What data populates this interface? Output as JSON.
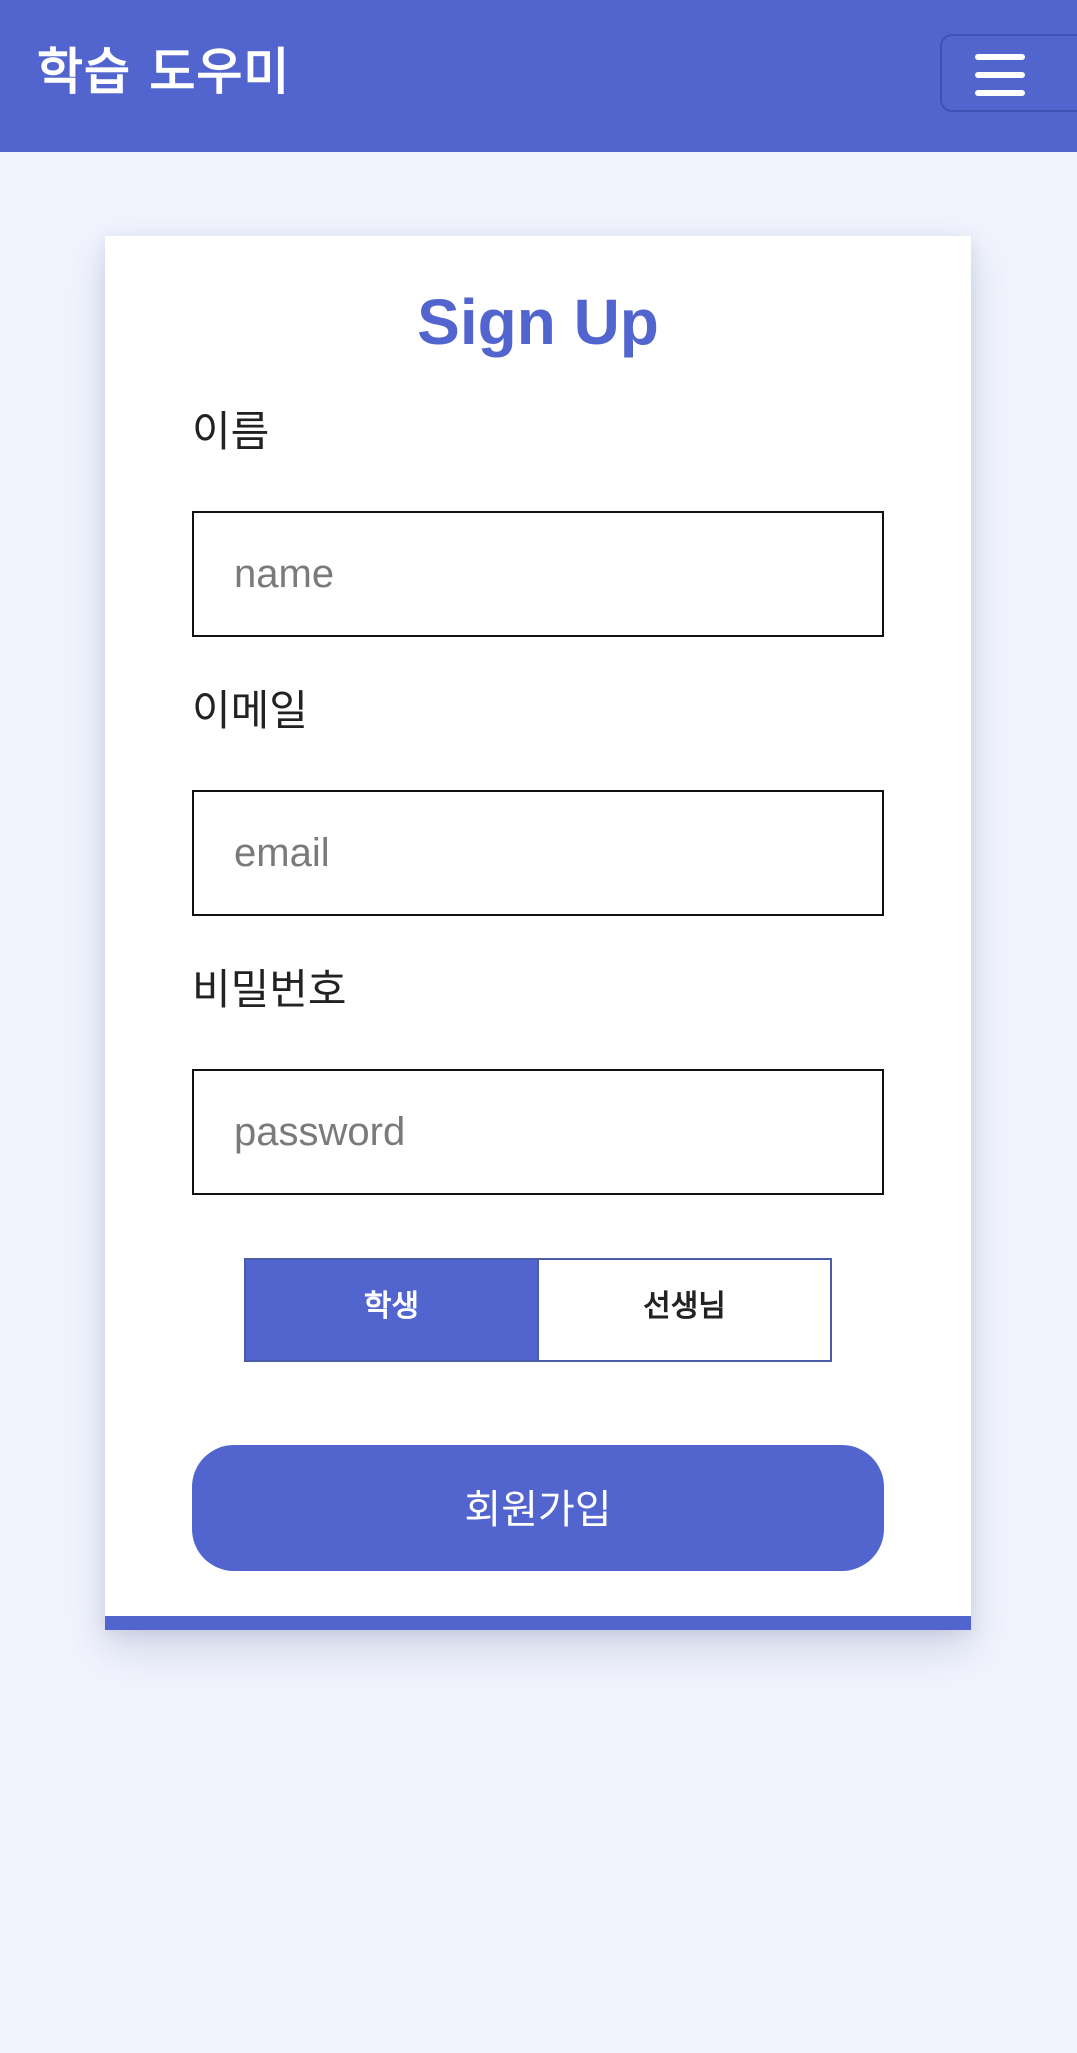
{
  "header": {
    "title": "학습 도우미",
    "menu_icon": "hamburger-menu-icon"
  },
  "form": {
    "title": "Sign Up",
    "fields": [
      {
        "label": "이름",
        "placeholder": "name",
        "value": ""
      },
      {
        "label": "이메일",
        "placeholder": "email",
        "value": ""
      },
      {
        "label": "비밀번호",
        "placeholder": "password",
        "value": ""
      }
    ],
    "roles": [
      {
        "label": "학생",
        "selected": true
      },
      {
        "label": "선생님",
        "selected": false
      }
    ],
    "submit_label": "회원가입"
  },
  "colors": {
    "accent": "#5265cf",
    "background": "#f1f4fd",
    "card": "#ffffff"
  }
}
